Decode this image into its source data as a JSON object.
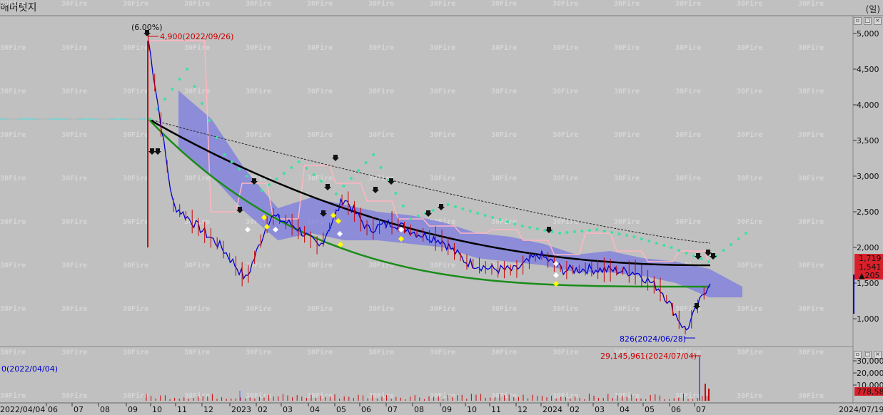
{
  "window": {
    "title": "해머럿지",
    "period_label": "(일)",
    "max_button": "□",
    "close_button": "×",
    "restore_button": "▫"
  },
  "watermark": "30Fire",
  "price_axis": {
    "ticks": [
      "5,000",
      "4,500",
      "4,000",
      "3,500",
      "3,000",
      "2,500",
      "2,000",
      "1,500",
      "1,000"
    ],
    "tick_values": [
      5000,
      4500,
      4000,
      3500,
      3000,
      2500,
      2000,
      1500,
      1000
    ],
    "badges": [
      {
        "text": "1,719",
        "color": "#d8202a"
      },
      {
        "text": "1,541",
        "color": "#d8202a"
      },
      {
        "text": "▲205",
        "color": "#d8202a"
      }
    ]
  },
  "volume_axis": {
    "ticks": [
      "30,000",
      "20,000",
      "10,000"
    ],
    "badge": {
      "text": "778,58",
      "color": "#d8202a"
    }
  },
  "date_axis": {
    "labels": [
      "2022/04/04",
      "06",
      "07",
      "08",
      "09",
      "10",
      "11",
      "12",
      "2023",
      "02",
      "03",
      "04",
      "05",
      "06",
      "07",
      "08",
      "09",
      "10",
      "11",
      "12",
      "2024",
      "02",
      "03",
      "04",
      "05",
      "06",
      "07",
      "2024/07/19"
    ]
  },
  "annotations": {
    "high": "4,900(2022/09/26)",
    "high_pct": "(6.00%)",
    "low": "826(2024/06/28)",
    "vol_high": "29,145,961(2024/07/04)",
    "vol_low": "0(2022/04/04)"
  },
  "colors": {
    "background": "#c0c0c0",
    "candle_line": "#0000cc",
    "ma_black": "#000000",
    "ma_green": "#1a8c1a",
    "ma_pink": "#ffb6c1",
    "cloud": "#7b7be0",
    "green_dots": "#40e0a0",
    "up_candle": "#cc0000"
  },
  "chart_data": {
    "type": "line",
    "title": "",
    "xlabel": "",
    "ylabel": "",
    "ylim": [
      800,
      5200
    ],
    "x": [
      "2022/09/26",
      "2022/10",
      "2022/11",
      "2022/12",
      "2023/01",
      "2023/02",
      "2023/03",
      "2023/04",
      "2023/05",
      "2023/06",
      "2023/07",
      "2023/08",
      "2023/09",
      "2023/10",
      "2023/11",
      "2023/12",
      "2024/01",
      "2024/02",
      "2024/03",
      "2024/04",
      "2024/05",
      "2024/06",
      "2024/06/28",
      "2024/07/19"
    ],
    "series": [
      {
        "name": "",
        "values": [
          4900,
          2600,
          2300,
          2000,
          1550,
          2450,
          2300,
          2000,
          2700,
          2250,
          2350,
          2200,
          2100,
          1800,
          1700,
          1680,
          1900,
          1680,
          1700,
          1680,
          1650,
          1400,
          826,
          1541
        ]
      }
    ]
  }
}
